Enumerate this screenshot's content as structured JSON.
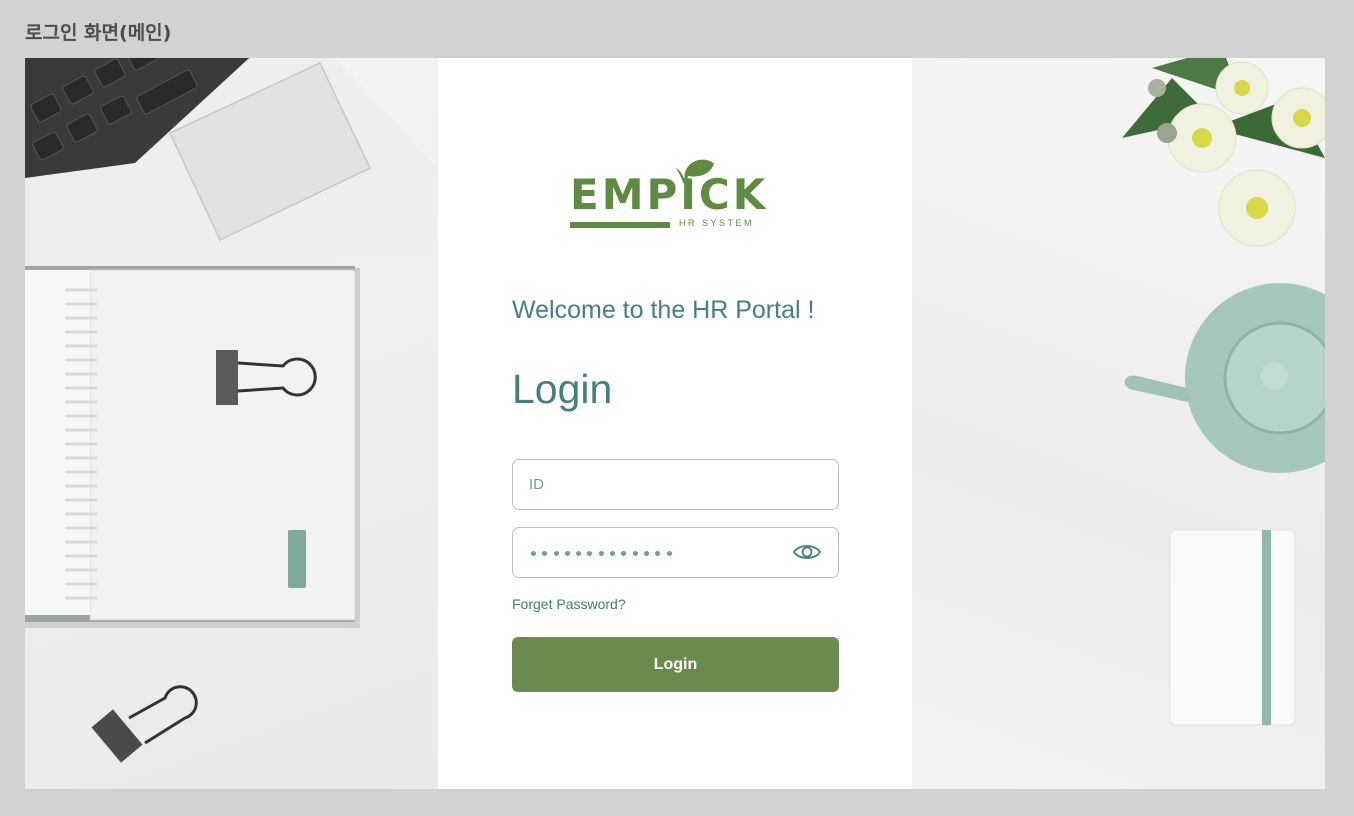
{
  "frame": {
    "title": "로그인 화면(메인)"
  },
  "brand": {
    "name": "EMPICK",
    "tagline": "HR SYSTEM"
  },
  "login_form": {
    "welcome": "Welcome to the HR Portal !",
    "title": "Login",
    "id_placeholder": "ID",
    "password_mask": "•••••••••••••",
    "forget_password": "Forget Password?",
    "submit_label": "Login"
  },
  "colors": {
    "brand_green": "#5f8a41",
    "button_green": "#6b8a4d",
    "teal_text": "#45807c",
    "page_background": "#d2d2d2"
  },
  "icons": {
    "password_toggle": "eye-icon",
    "logo_mark": "leaf-icon"
  }
}
